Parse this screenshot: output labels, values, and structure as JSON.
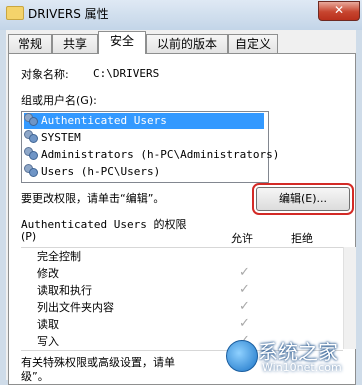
{
  "window": {
    "title": "DRIVERS 属性",
    "close_glyph": "✕"
  },
  "tabs": [
    {
      "label": "常规"
    },
    {
      "label": "共享"
    },
    {
      "label": "安全"
    },
    {
      "label": "以前的版本"
    },
    {
      "label": "自定义"
    }
  ],
  "security": {
    "object_label": "对象名称:",
    "object_value": "C:\\DRIVERS",
    "group_label": "组或用户名(G):",
    "users": [
      {
        "name": "Authenticated Users"
      },
      {
        "name": "SYSTEM"
      },
      {
        "name": "Administrators (h-PC\\Administrators)"
      },
      {
        "name": "Users (h-PC\\Users)"
      }
    ],
    "change_hint": "要更改权限，请单击“编辑”。",
    "edit_button": "编辑(E)...",
    "perm_title": "Authenticated Users 的权限",
    "perm_title_suffix": "(P)",
    "allow_header": "允许",
    "deny_header": "拒绝",
    "permissions": [
      {
        "name": "完全控制",
        "allow": false
      },
      {
        "name": "修改",
        "allow": true
      },
      {
        "name": "读取和执行",
        "allow": true
      },
      {
        "name": "列出文件夹内容",
        "allow": true
      },
      {
        "name": "读取",
        "allow": true
      },
      {
        "name": "写入",
        "allow": true
      }
    ],
    "special_hint_1": "有关特殊权限或高级设置，请单",
    "special_hint_2": "级”。"
  },
  "watermark": {
    "brand": "系统之家",
    "url": "Win10net.com"
  }
}
